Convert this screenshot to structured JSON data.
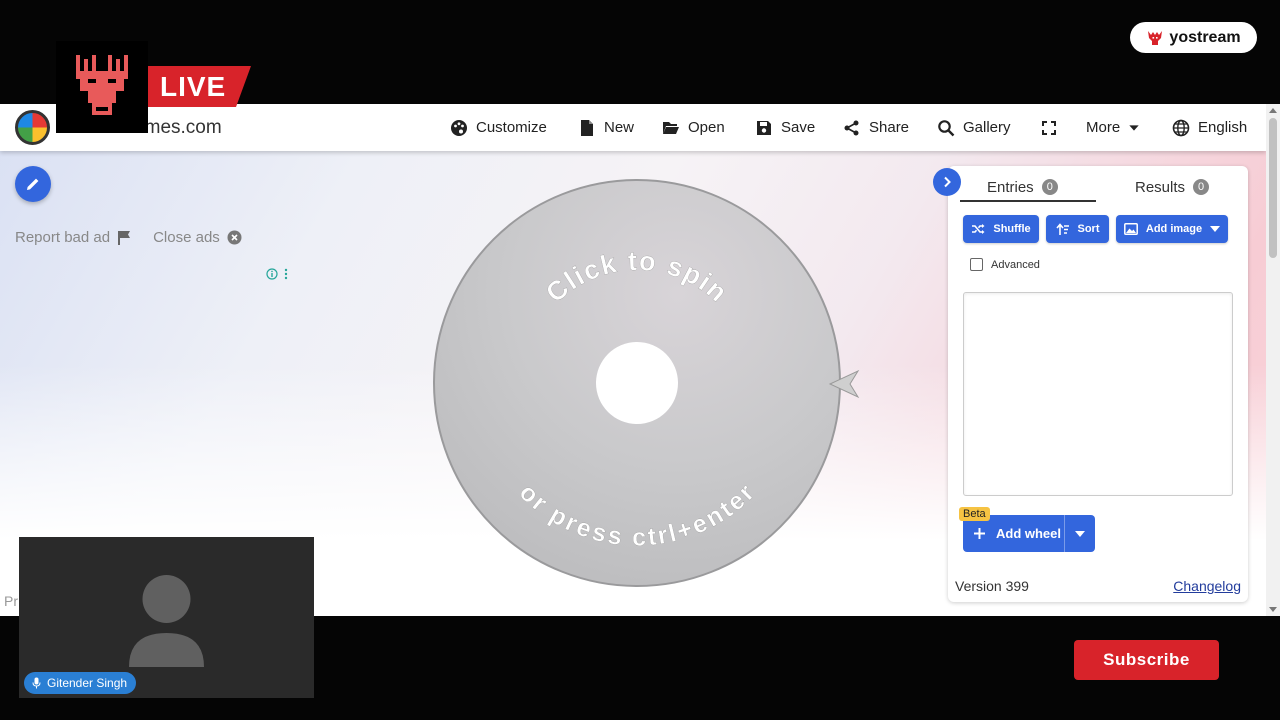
{
  "colors": {
    "accent": "#3366dd",
    "live_red": "#d8232a",
    "subscribe_red": "#d8232a",
    "name_tag_blue": "#2a7fd4"
  },
  "stream": {
    "live_label": "LIVE",
    "brand_label": "yostream",
    "subscribe_label": "Subscribe",
    "participant_name": "Gitender Singh"
  },
  "site": {
    "name": "wheelofnames.com"
  },
  "navbar": {
    "customize": "Customize",
    "new": "New",
    "open": "Open",
    "save": "Save",
    "share": "Share",
    "gallery": "Gallery",
    "more": "More",
    "language": "English"
  },
  "ads": {
    "report_label": "Report bad ad",
    "close_label": "Close ads",
    "footer_fragment": "Pr"
  },
  "wheel": {
    "top_text": "Click to spin",
    "bottom_text": "or press ctrl+enter"
  },
  "panel": {
    "tabs": [
      {
        "label": "Entries",
        "count": "0"
      },
      {
        "label": "Results",
        "count": "0"
      }
    ],
    "shuffle_label": "Shuffle",
    "sort_label": "Sort",
    "add_image_label": "Add image",
    "advanced_label": "Advanced",
    "add_wheel_label": "Add wheel",
    "beta_label": "Beta",
    "version_label": "Version 399",
    "changelog_label": "Changelog"
  }
}
